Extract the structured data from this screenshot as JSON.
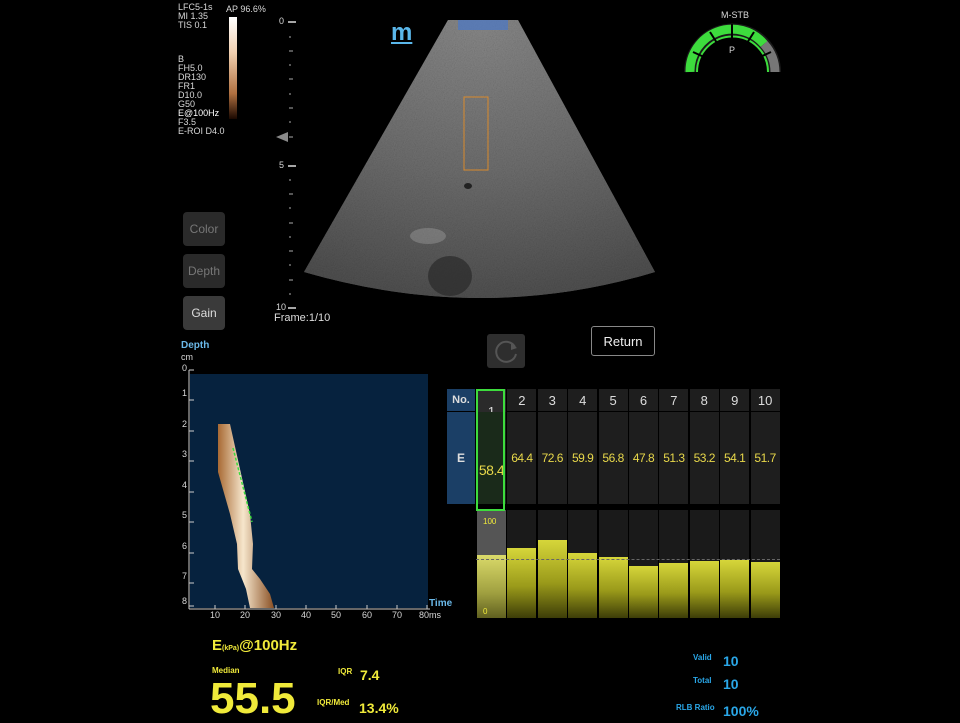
{
  "header": {
    "probe": "LFC5-1s",
    "mi": "MI 1.35",
    "tis": "TIS 0.1",
    "ap": "AP 96.6%",
    "mode_params": [
      "B",
      "FH5.0",
      "DR130",
      "FR1",
      "D10.0",
      "G50",
      "E@100Hz",
      "F3.5",
      "E-ROI D4.0"
    ],
    "stability_label": "M-STB",
    "stability_mark": "P",
    "logo_mark": "m"
  },
  "image": {
    "depth_ticks": [
      "0",
      "5",
      "10"
    ],
    "frame": "Frame:1/10"
  },
  "side_buttons": [
    "Color",
    "Depth",
    "Gain"
  ],
  "return_label": "Return",
  "mmode": {
    "title": "Depth",
    "unit": "cm",
    "y_ticks": [
      "0",
      "1",
      "2",
      "3",
      "4",
      "5",
      "6",
      "7",
      "8"
    ],
    "x_ticks": [
      "10",
      "20",
      "30",
      "40",
      "50",
      "60",
      "70",
      "80"
    ],
    "x_label": "Time",
    "x_unit": "ms"
  },
  "measure_table": {
    "no_label": "No.",
    "e_label": "E",
    "numbers": [
      "1",
      "2",
      "3",
      "4",
      "5",
      "6",
      "7",
      "8",
      "9",
      "10"
    ],
    "values": [
      "58.4",
      "64.4",
      "72.6",
      "59.9",
      "56.8",
      "47.8",
      "51.3",
      "53.2",
      "54.1",
      "51.7"
    ],
    "bar_fraction": [
      0.584,
      0.644,
      0.726,
      0.599,
      0.568,
      0.478,
      0.513,
      0.532,
      0.541,
      0.517
    ],
    "bar_max_label": "100",
    "bar_min_label": "0"
  },
  "results": {
    "title": "E",
    "title_unit": "(kPa)",
    "title_freq": "@100Hz",
    "median_label": "Median",
    "median": "55.5",
    "iqr_label": "IQR",
    "iqr": "7.4",
    "iqr_med_label": "IQR/Med",
    "iqr_med": "13.4%",
    "valid_label": "Valid",
    "valid": "10",
    "total_label": "Total",
    "total": "10",
    "ratio_label": "RLB Ratio",
    "ratio": "100%"
  },
  "colors": {
    "accent_yellow": "#f0ea3a",
    "accent_blue": "#2aa7e8",
    "selected_green": "#3ddc3d"
  }
}
